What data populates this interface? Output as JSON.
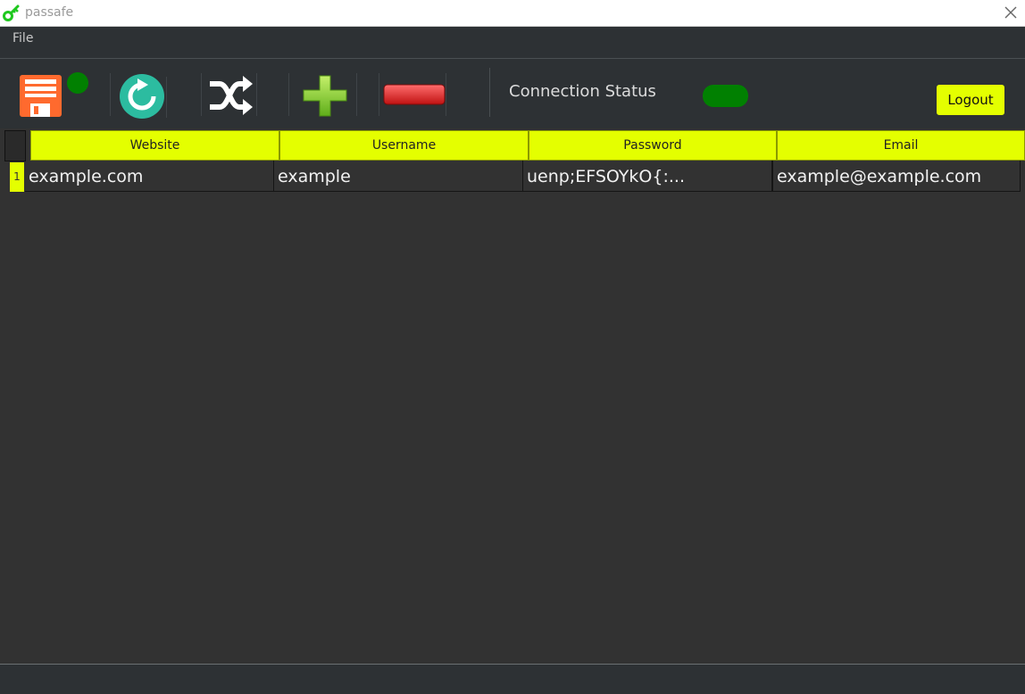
{
  "window": {
    "title": "passafe"
  },
  "menu": {
    "file_label": "File"
  },
  "toolbar": {
    "icons": [
      "floppy-disk-save-icon",
      "refresh-icon",
      "shuffle-icon",
      "plus-icon",
      "minus-icon"
    ],
    "connection_label": "Connection Status",
    "connection_color": "#018001",
    "logout_label": "Logout",
    "accent": "#e4ff00"
  },
  "table": {
    "columns": [
      "Website",
      "Username",
      "Password",
      "Email"
    ],
    "rows": [
      {
        "num": "1",
        "website": "example.com",
        "username": "example",
        "password": "uenp;EFSOYkO{:...",
        "email": "example@example.com"
      }
    ]
  }
}
